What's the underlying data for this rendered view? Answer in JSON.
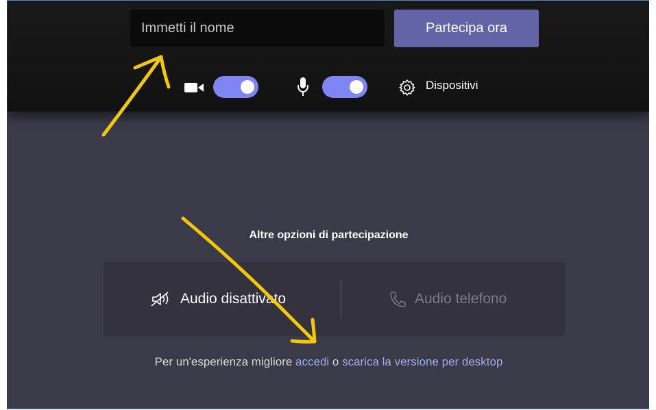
{
  "prejoin": {
    "name_placeholder": "Immetti il nome",
    "join_label": "Partecipa ora",
    "camera_on": true,
    "mic_on": true,
    "devices_label": "Dispositivi"
  },
  "options": {
    "title": "Altre opzioni di partecipazione",
    "audio_off_label": "Audio disattivato",
    "phone_audio_label": "Audio telefono"
  },
  "footer": {
    "prefix": "Per un'esperienza migliore ",
    "signin_link": "accedi",
    "middle": " o ",
    "download_link": "scarica la versione per desktop"
  },
  "colors": {
    "accent": "#6264a7",
    "toggle": "#7f85f5",
    "link": "#a5a9f4",
    "annotation": "#f3c800"
  }
}
